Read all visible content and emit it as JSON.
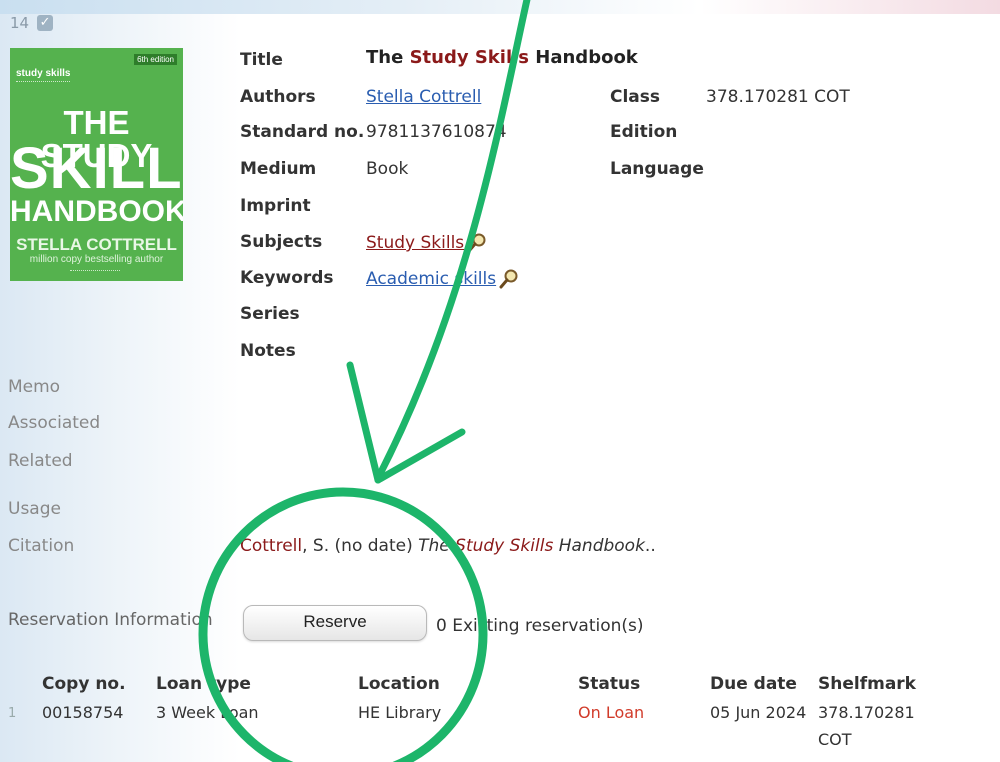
{
  "record": {
    "number": "14",
    "checked": "✓"
  },
  "cover": {
    "edition_badge": "6th edition",
    "series": "study skills",
    "line1": "THE STUDY",
    "line2": "SKILLS",
    "line3": "HANDBOOK",
    "author": "STELLA COTTRELL",
    "tagline": "million copy bestselling author",
    "bg_color": "#55b24e"
  },
  "fields": {
    "title_label": "Title",
    "title_pre": "The ",
    "title_hl": "Study Skills",
    "title_post": " Handbook",
    "authors_label": "Authors",
    "authors_value": "Stella Cottrell",
    "standard_label": "Standard no.",
    "standard_value": "9781137610874",
    "medium_label": "Medium",
    "medium_value": "Book",
    "imprint_label": "Imprint",
    "subjects_label": "Subjects",
    "subjects_value": "Study Skills",
    "keywords_label": "Keywords",
    "keywords_value": "Academic skills",
    "series_label": "Series",
    "notes_label": "Notes",
    "class_label": "Class",
    "class_value": "378.170281 COT",
    "edition_label": "Edition",
    "language_label": "Language"
  },
  "side": {
    "memo": "Memo",
    "associated": "Associated",
    "related": "Related",
    "usage": "Usage",
    "citation": "Citation"
  },
  "citation": {
    "author": "Cottrell",
    "middle": ", S. (no date) ",
    "title_pre": "The ",
    "title_hl": "Study Skills",
    "title_post": " Handbook",
    "end": ".."
  },
  "reservation": {
    "label": "Reservation Information",
    "button": "Reserve",
    "existing": "0 Existing reservation(s)"
  },
  "copies": {
    "headers": [
      "Copy no.",
      "Loan type",
      "Location",
      "Status",
      "Due date",
      "Shelfmark"
    ],
    "rows": [
      {
        "index": "1",
        "copy": "00158754",
        "loan": "3 Week Loan",
        "location": "HE Library",
        "status": "On Loan",
        "due": "05 Jun 2024",
        "shelf1": "378.170281",
        "shelf2": "COT"
      }
    ]
  },
  "colors": {
    "annotation": "#1db56a",
    "status_on_loan": "#d13b2a",
    "link": "#2a5db0",
    "highlight": "#8b1a1a"
  },
  "icons": [
    "magnifier-icon",
    "checkbox-icon"
  ]
}
